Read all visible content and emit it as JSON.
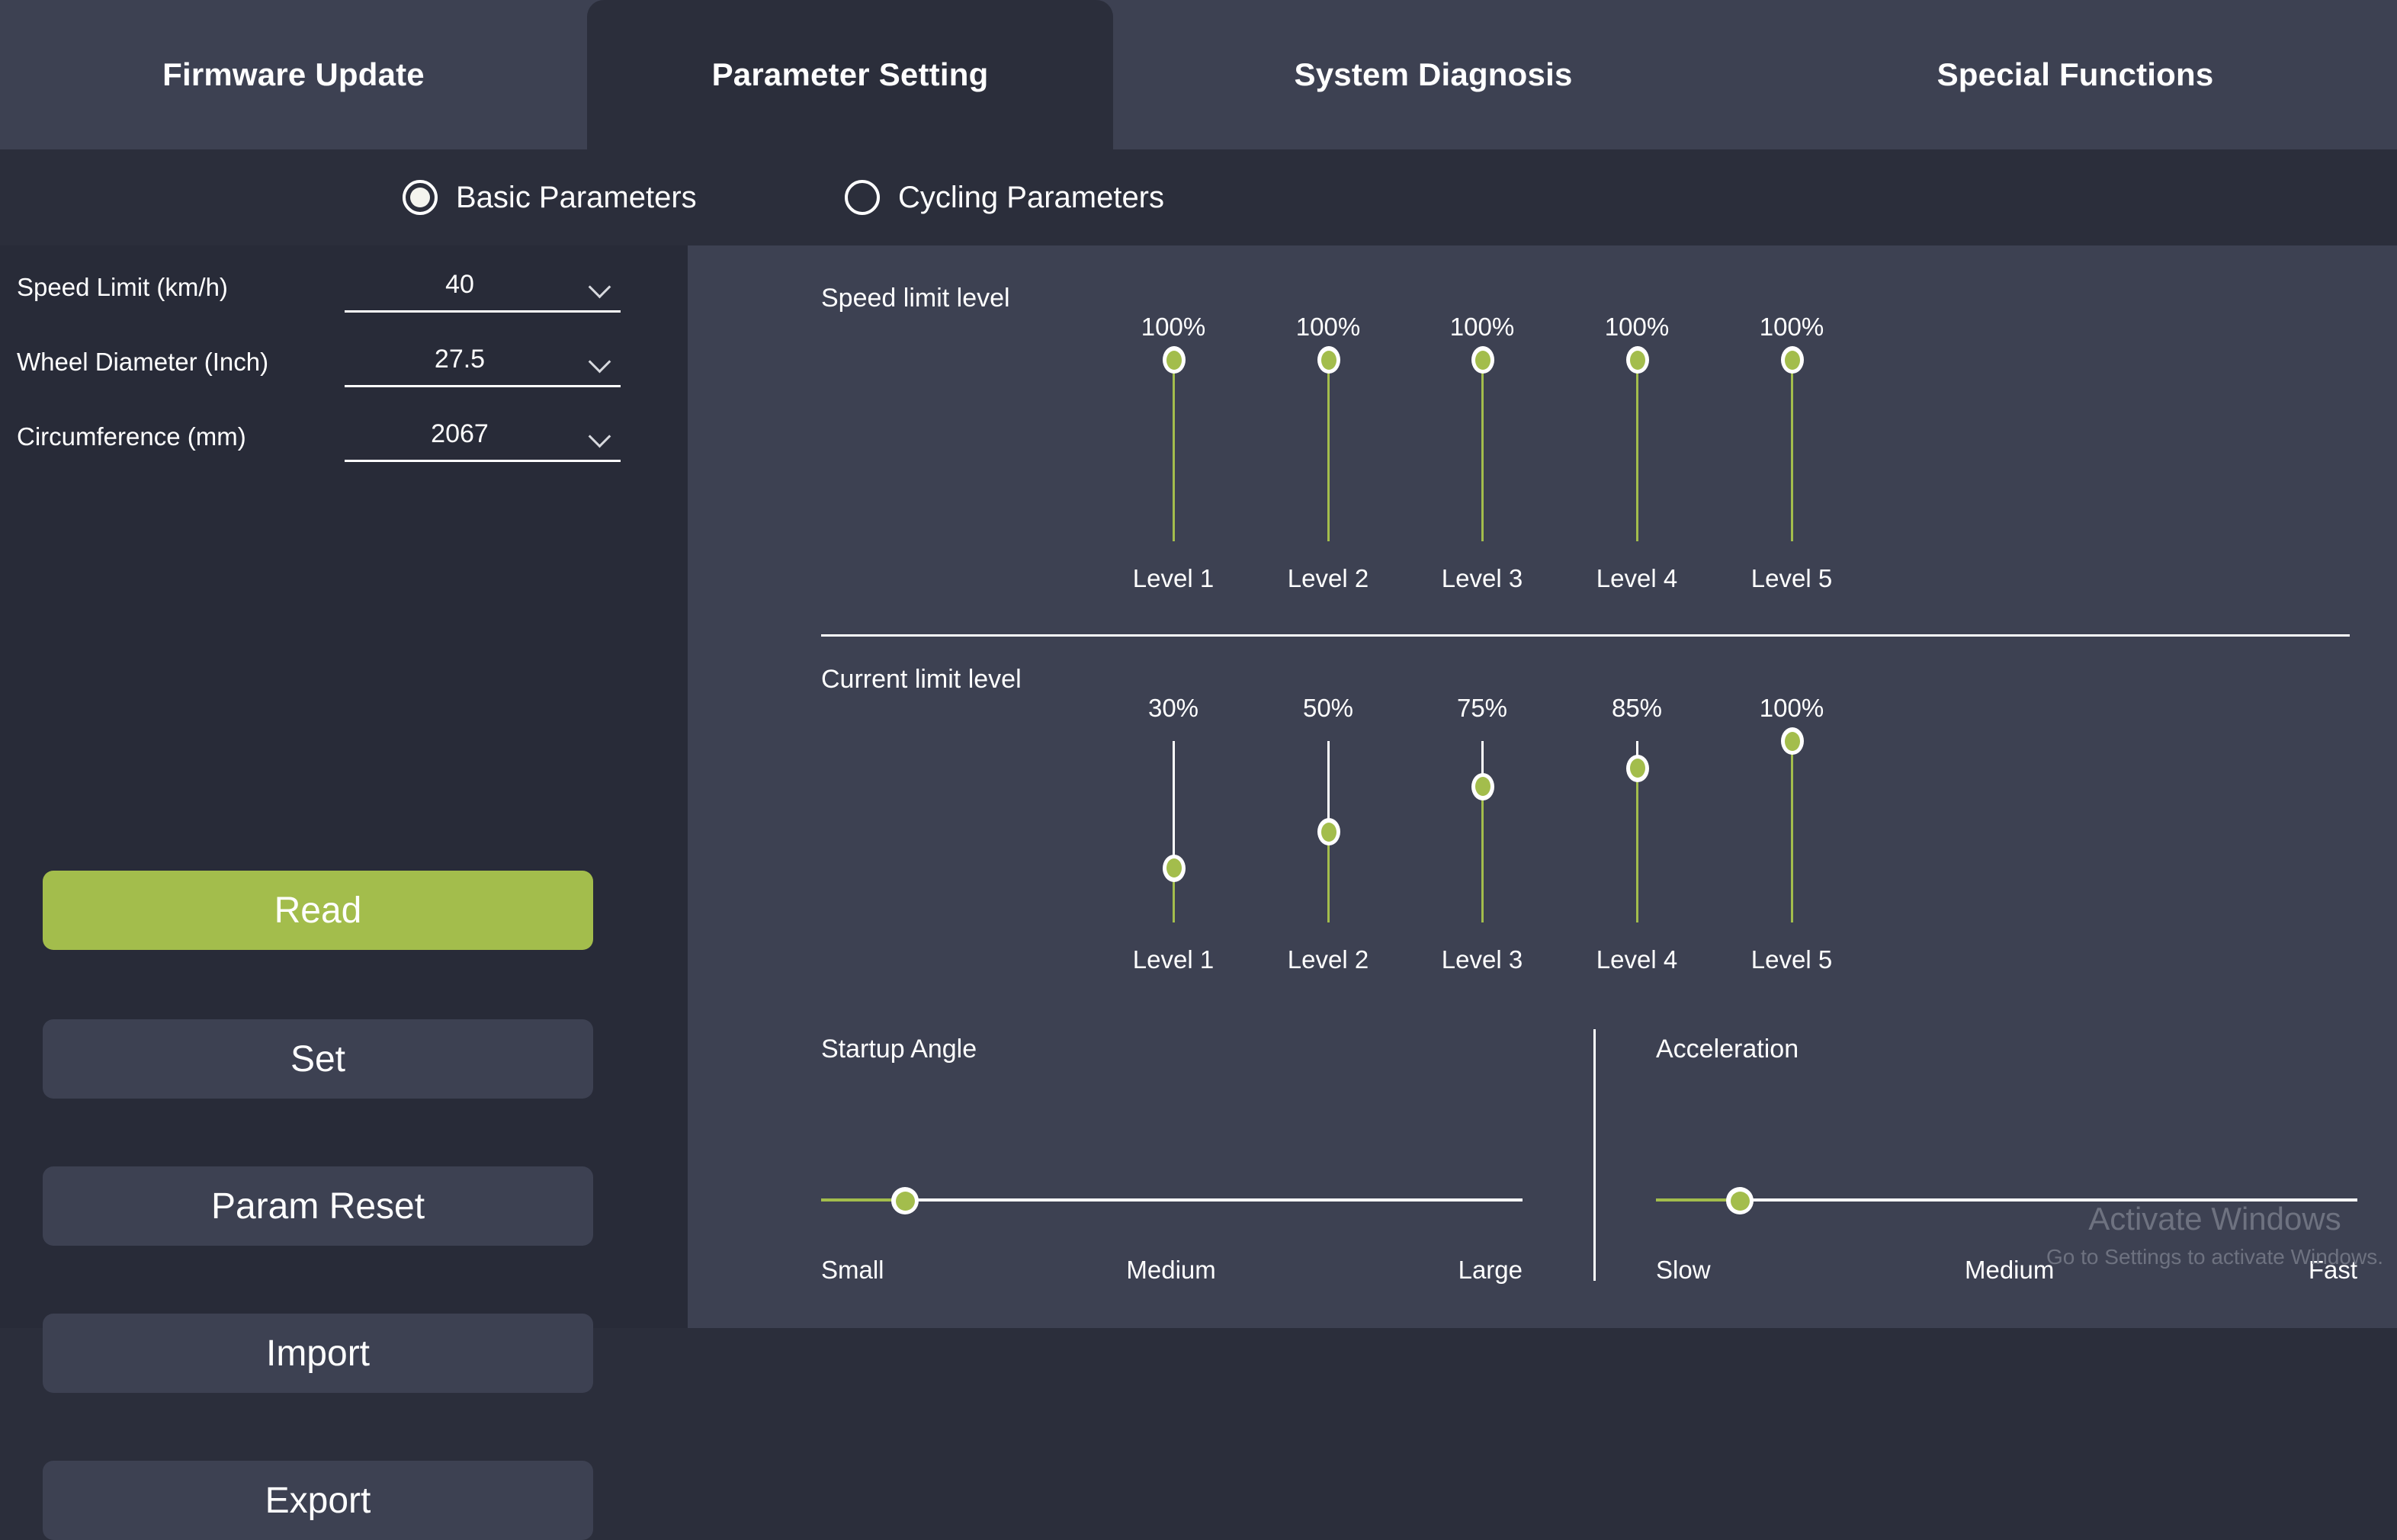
{
  "tabs": [
    {
      "label": "Firmware Update",
      "active": false
    },
    {
      "label": "Parameter Setting",
      "active": true
    },
    {
      "label": "System Diagnosis",
      "active": false
    },
    {
      "label": "Special Functions",
      "active": false
    }
  ],
  "param_mode": {
    "options": [
      {
        "label": "Basic Parameters",
        "selected": true
      },
      {
        "label": "Cycling Parameters",
        "selected": false
      }
    ]
  },
  "sidebar": {
    "fields": [
      {
        "label": "Speed Limit (km/h)",
        "value": "40",
        "icon": "chevron-down-icon"
      },
      {
        "label": "Wheel Diameter (Inch)",
        "value": "27.5",
        "icon": "chevron-down-icon"
      },
      {
        "label": "Circumference (mm)",
        "value": "2067",
        "icon": "chevron-down-icon"
      }
    ],
    "buttons": [
      {
        "label": "Read",
        "primary": true
      },
      {
        "label": "Set",
        "primary": false
      },
      {
        "label": "Param Reset",
        "primary": false
      },
      {
        "label": "Import",
        "primary": false
      },
      {
        "label": "Export",
        "primary": false
      }
    ]
  },
  "main": {
    "speed_limit_level": {
      "title": "Speed limit level",
      "levels": [
        {
          "name": "Level 1",
          "percent": "100%",
          "value": 100
        },
        {
          "name": "Level 2",
          "percent": "100%",
          "value": 100
        },
        {
          "name": "Level 3",
          "percent": "100%",
          "value": 100
        },
        {
          "name": "Level 4",
          "percent": "100%",
          "value": 100
        },
        {
          "name": "Level 5",
          "percent": "100%",
          "value": 100
        }
      ]
    },
    "current_limit_level": {
      "title": "Current limit level",
      "levels": [
        {
          "name": "Level 1",
          "percent": "30%",
          "value": 30
        },
        {
          "name": "Level 2",
          "percent": "50%",
          "value": 50
        },
        {
          "name": "Level 3",
          "percent": "75%",
          "value": 75
        },
        {
          "name": "Level 4",
          "percent": "85%",
          "value": 85
        },
        {
          "name": "Level 5",
          "percent": "100%",
          "value": 100
        }
      ]
    },
    "startup_angle": {
      "title": "Startup Angle",
      "value": 12,
      "ticks": [
        "Small",
        "Medium",
        "Large"
      ]
    },
    "acceleration": {
      "title": "Acceleration",
      "value": 12,
      "ticks": [
        "Slow",
        "Medium",
        "Fast"
      ]
    }
  },
  "watermark": {
    "title": "Activate Windows",
    "subtitle": "Go to Settings to activate Windows."
  },
  "colors": {
    "accent_green": "#a3bd4c",
    "panel_bg": "#3d4152",
    "sidebar_bg": "#282b38",
    "page_bg": "#2b2e3b",
    "text": "#ffffff"
  }
}
